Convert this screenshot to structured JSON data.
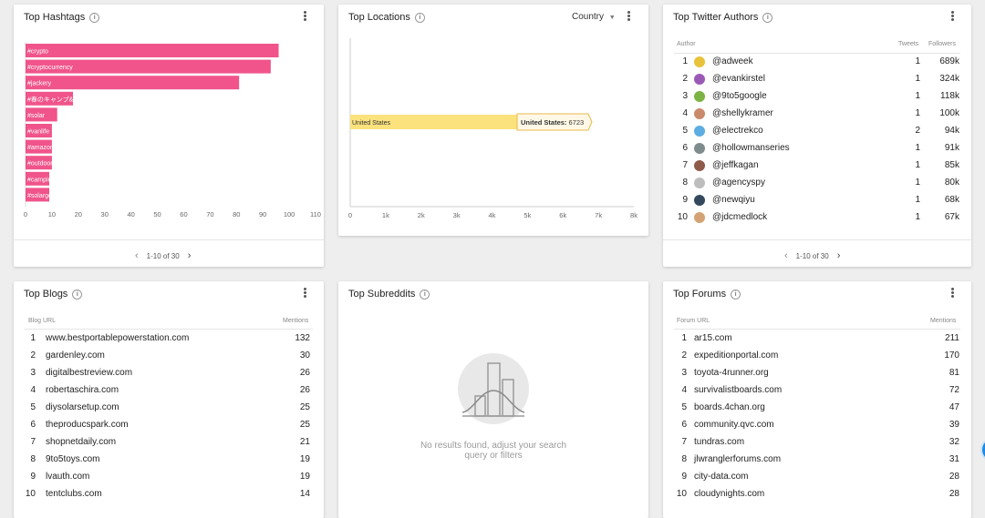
{
  "hashtags": {
    "title": "Top Hashtags",
    "pager": "1-10 of 30",
    "chart_data": {
      "type": "bar",
      "orientation": "horizontal",
      "categories": [
        "#crypto",
        "#cryptocurrency",
        "#jackery",
        "#春のキャンプ&jackery&",
        "#solar",
        "#vanlife",
        "#amazon",
        "#outdoor",
        "#camping",
        "#solargeneratorxuhuong"
      ],
      "values": [
        96,
        93,
        81,
        18,
        12,
        10,
        10,
        10,
        9,
        9
      ],
      "xlim": [
        0,
        110
      ],
      "xticks": [
        0,
        10,
        20,
        30,
        40,
        50,
        60,
        70,
        80,
        90,
        100,
        110
      ],
      "bar_color": "#f0548a"
    }
  },
  "locations": {
    "title": "Top Locations",
    "dropdown_value": "Country",
    "chart_data": {
      "type": "bar",
      "orientation": "horizontal",
      "categories": [
        "United States"
      ],
      "values": [
        6723
      ],
      "xlim": [
        0,
        8000
      ],
      "xticks": [
        "0",
        "1k",
        "2k",
        "3k",
        "4k",
        "5k",
        "6k",
        "7k",
        "8k"
      ],
      "bar_color": "#fbe27d",
      "tooltip_label": "United States",
      "tooltip_value": "6723"
    }
  },
  "twitter": {
    "title": "Top Twitter Authors",
    "col_author": "Author",
    "col_tweets": "Tweets",
    "col_followers": "Followers",
    "pager": "1-10 of 30",
    "rows": [
      {
        "idx": "1",
        "name": "@adweek",
        "tweets": "1",
        "followers": "689k",
        "avatar_color": "#e8c33a"
      },
      {
        "idx": "2",
        "name": "@evankirstel",
        "tweets": "1",
        "followers": "324k",
        "avatar_color": "#9b59b6"
      },
      {
        "idx": "3",
        "name": "@9to5google",
        "tweets": "1",
        "followers": "118k",
        "avatar_color": "#7cb342"
      },
      {
        "idx": "4",
        "name": "@shellykramer",
        "tweets": "1",
        "followers": "100k",
        "avatar_color": "#c98a6b"
      },
      {
        "idx": "5",
        "name": "@electrekco",
        "tweets": "2",
        "followers": "94k",
        "avatar_color": "#5dade2"
      },
      {
        "idx": "6",
        "name": "@hollowmanseries",
        "tweets": "1",
        "followers": "91k",
        "avatar_color": "#7f8c8d"
      },
      {
        "idx": "7",
        "name": "@jeffkagan",
        "tweets": "1",
        "followers": "85k",
        "avatar_color": "#8e5a4a"
      },
      {
        "idx": "8",
        "name": "@agencyspy",
        "tweets": "1",
        "followers": "80k",
        "avatar_color": "#bdbdbd"
      },
      {
        "idx": "9",
        "name": "@newqiyu",
        "tweets": "1",
        "followers": "68k",
        "avatar_color": "#34495e"
      },
      {
        "idx": "10",
        "name": "@jdcmedlock",
        "tweets": "1",
        "followers": "67k",
        "avatar_color": "#d4a373"
      }
    ]
  },
  "blogs": {
    "title": "Top Blogs",
    "col_url": "Blog URL",
    "col_mentions": "Mentions",
    "rows": [
      {
        "idx": "1",
        "url": "www.bestportablepowerstation.com",
        "mentions": "132"
      },
      {
        "idx": "2",
        "url": "gardenley.com",
        "mentions": "30"
      },
      {
        "idx": "3",
        "url": "digitalbestreview.com",
        "mentions": "26"
      },
      {
        "idx": "4",
        "url": "robertaschira.com",
        "mentions": "26"
      },
      {
        "idx": "5",
        "url": "diysolarsetup.com",
        "mentions": "25"
      },
      {
        "idx": "6",
        "url": "theproducspark.com",
        "mentions": "25"
      },
      {
        "idx": "7",
        "url": "shopnetdaily.com",
        "mentions": "21"
      },
      {
        "idx": "8",
        "url": "9to5toys.com",
        "mentions": "19"
      },
      {
        "idx": "9",
        "url": "lvauth.com",
        "mentions": "19"
      },
      {
        "idx": "10",
        "url": "tentclubs.com",
        "mentions": "14"
      }
    ]
  },
  "subreddits": {
    "title": "Top Subreddits",
    "empty_line1": "No results found, adjust your search",
    "empty_line2": "query or filters"
  },
  "forums": {
    "title": "Top Forums",
    "col_url": "Forum URL",
    "col_mentions": "Mentions",
    "rows": [
      {
        "idx": "1",
        "url": "ar15.com",
        "mentions": "211"
      },
      {
        "idx": "2",
        "url": "expeditionportal.com",
        "mentions": "170"
      },
      {
        "idx": "3",
        "url": "toyota-4runner.org",
        "mentions": "81"
      },
      {
        "idx": "4",
        "url": "survivalistboards.com",
        "mentions": "72"
      },
      {
        "idx": "5",
        "url": "boards.4chan.org",
        "mentions": "47"
      },
      {
        "idx": "6",
        "url": "community.qvc.com",
        "mentions": "39"
      },
      {
        "idx": "7",
        "url": "tundras.com",
        "mentions": "32"
      },
      {
        "idx": "8",
        "url": "jlwranglerforums.com",
        "mentions": "31"
      },
      {
        "idx": "9",
        "url": "city-data.com",
        "mentions": "28"
      },
      {
        "idx": "10",
        "url": "cloudynights.com",
        "mentions": "28"
      }
    ]
  }
}
